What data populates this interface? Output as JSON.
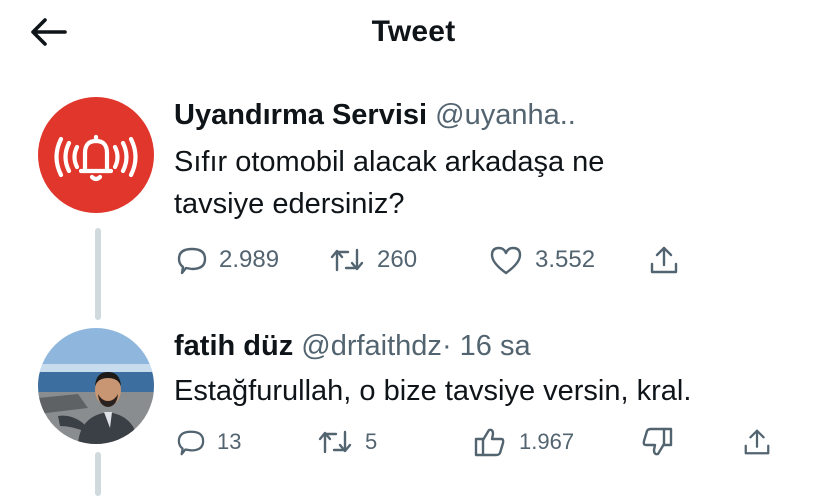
{
  "header": {
    "title": "Tweet"
  },
  "tweet": {
    "display_name": "Uyandırma Servisi",
    "handle": "@uyanha..",
    "text_line1": "Sıfır otomobil alacak arkadaşa ne",
    "text_line2": "tavsiye edersiniz?",
    "replies": "2.989",
    "retweets": "260",
    "likes": "3.552",
    "avatar_color": "#e0362c"
  },
  "reply": {
    "display_name": "fatih düz",
    "handle": "@drfaithdz",
    "separator": "·",
    "time": "16 sa",
    "text": "Estağfurullah, o bize tavsiye versin, kral.",
    "replies": "13",
    "retweets": "5",
    "likes": "1.967"
  },
  "colors": {
    "text": "#0f1419",
    "secondary": "#536471",
    "thread_line": "#cfd9de"
  }
}
